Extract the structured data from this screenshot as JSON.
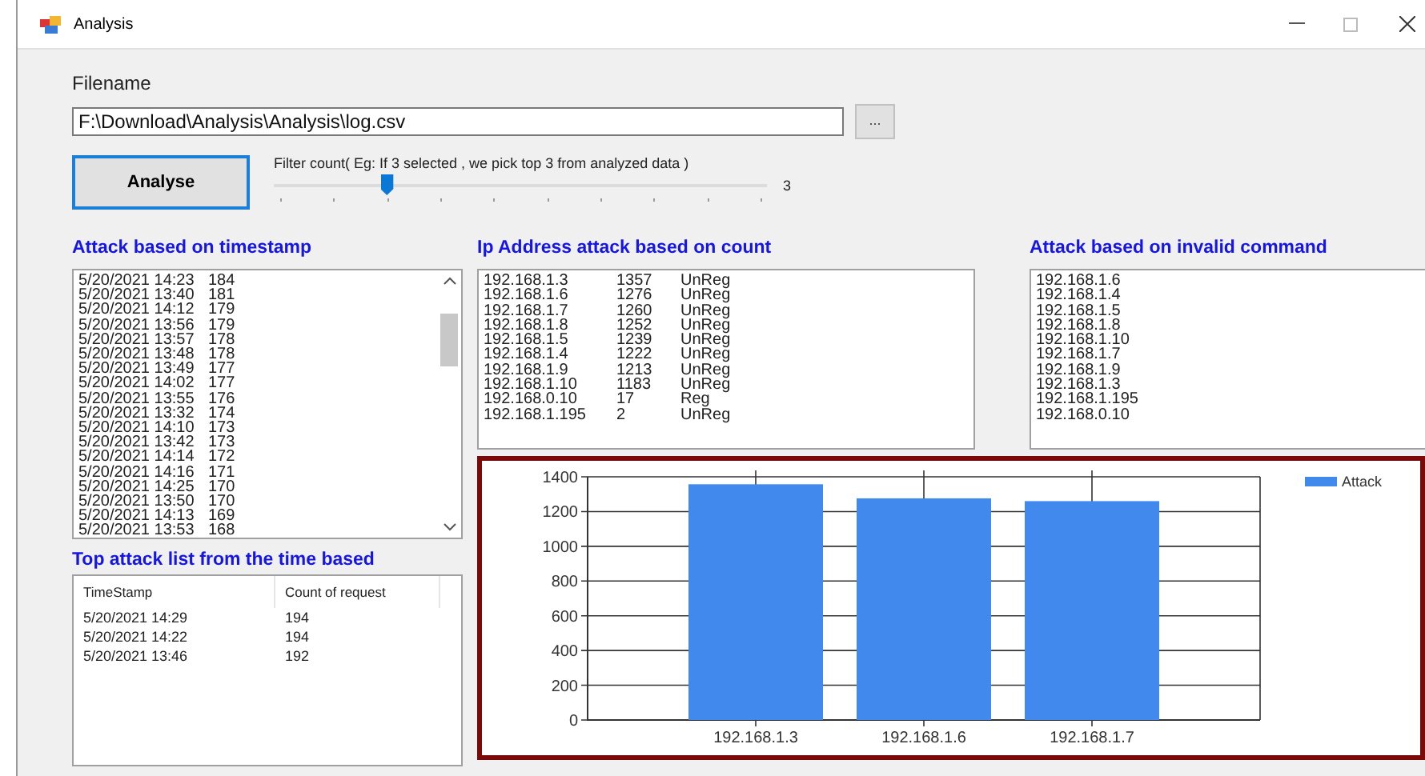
{
  "window": {
    "title": "Analysis"
  },
  "filename": {
    "label": "Filename",
    "value": "F:\\Download\\Analysis\\Analysis\\log.csv",
    "browse_button": "..."
  },
  "analyse_button": "Analyse",
  "filter": {
    "label": "Filter count( Eg: If 3 selected , we pick top 3 from analyzed data )",
    "level": 0.2222,
    "reading": "3"
  },
  "timestamp_attacks": {
    "heading": "Attack based on timestamp",
    "rows": [
      {
        "time": "5/20/2021 14:23",
        "count": "184"
      },
      {
        "time": "5/20/2021 13:40",
        "count": "181"
      },
      {
        "time": "5/20/2021 14:12",
        "count": "179"
      },
      {
        "time": "5/20/2021 13:56",
        "count": "179"
      },
      {
        "time": "5/20/2021 13:57",
        "count": "178"
      },
      {
        "time": "5/20/2021 13:48",
        "count": "178"
      },
      {
        "time": "5/20/2021 13:49",
        "count": "177"
      },
      {
        "time": "5/20/2021 14:02",
        "count": "177"
      },
      {
        "time": "5/20/2021 13:55",
        "count": "176"
      },
      {
        "time": "5/20/2021 13:32",
        "count": "174"
      },
      {
        "time": "5/20/2021 14:10",
        "count": "173"
      },
      {
        "time": "5/20/2021 13:42",
        "count": "173"
      },
      {
        "time": "5/20/2021 14:14",
        "count": "172"
      },
      {
        "time": "5/20/2021 14:16",
        "count": "171"
      },
      {
        "time": "5/20/2021 14:25",
        "count": "170"
      },
      {
        "time": "5/20/2021 13:50",
        "count": "170"
      },
      {
        "time": "5/20/2021 14:13",
        "count": "169"
      },
      {
        "time": "5/20/2021 13:53",
        "count": "168"
      }
    ]
  },
  "ip_attacks": {
    "heading": "Ip Address attack based on count",
    "rows": [
      {
        "ip": "192.168.1.3",
        "count": "1357",
        "status": "UnReg"
      },
      {
        "ip": "192.168.1.6",
        "count": "1276",
        "status": "UnReg"
      },
      {
        "ip": "192.168.1.7",
        "count": "1260",
        "status": "UnReg"
      },
      {
        "ip": "192.168.1.8",
        "count": "1252",
        "status": "UnReg"
      },
      {
        "ip": "192.168.1.5",
        "count": "1239",
        "status": "UnReg"
      },
      {
        "ip": "192.168.1.4",
        "count": "1222",
        "status": "UnReg"
      },
      {
        "ip": "192.168.1.9",
        "count": "1213",
        "status": "UnReg"
      },
      {
        "ip": "192.168.1.10",
        "count": "1183",
        "status": "UnReg"
      },
      {
        "ip": "192.168.0.10",
        "count": "17",
        "status": "Reg"
      },
      {
        "ip": "192.168.1.195",
        "count": "2",
        "status": "UnReg"
      }
    ]
  },
  "invalid_command_attacks": {
    "heading": "Attack based on invalid command",
    "rows": [
      "192.168.1.6",
      "192.168.1.4",
      "192.168.1.5",
      "192.168.1.8",
      "192.168.1.10",
      "192.168.1.7",
      "192.168.1.9",
      "192.168.1.3",
      "192.168.1.195",
      "192.168.0.10"
    ]
  },
  "top_attacks": {
    "heading": "Top attack list from the time based",
    "columns": [
      "TimeStamp",
      "Count of request"
    ],
    "rows": [
      [
        "5/20/2021 14:29",
        "194"
      ],
      [
        "5/20/2021 14:22",
        "194"
      ],
      [
        "5/20/2021 13:46",
        "192"
      ]
    ]
  },
  "chart": {
    "chart_data": {
      "type": "bar",
      "categories": [
        "192.168.1.3",
        "192.168.1.6",
        "192.168.1.7"
      ],
      "series": [
        {
          "name": "Attack",
          "color": "#4189ec",
          "values": [
            1357,
            1276,
            1260
          ]
        }
      ],
      "grid": true,
      "ylim": [
        0,
        1400
      ],
      "yticks": [
        0,
        200,
        400,
        600,
        800,
        1000,
        1200,
        1400
      ]
    }
  }
}
